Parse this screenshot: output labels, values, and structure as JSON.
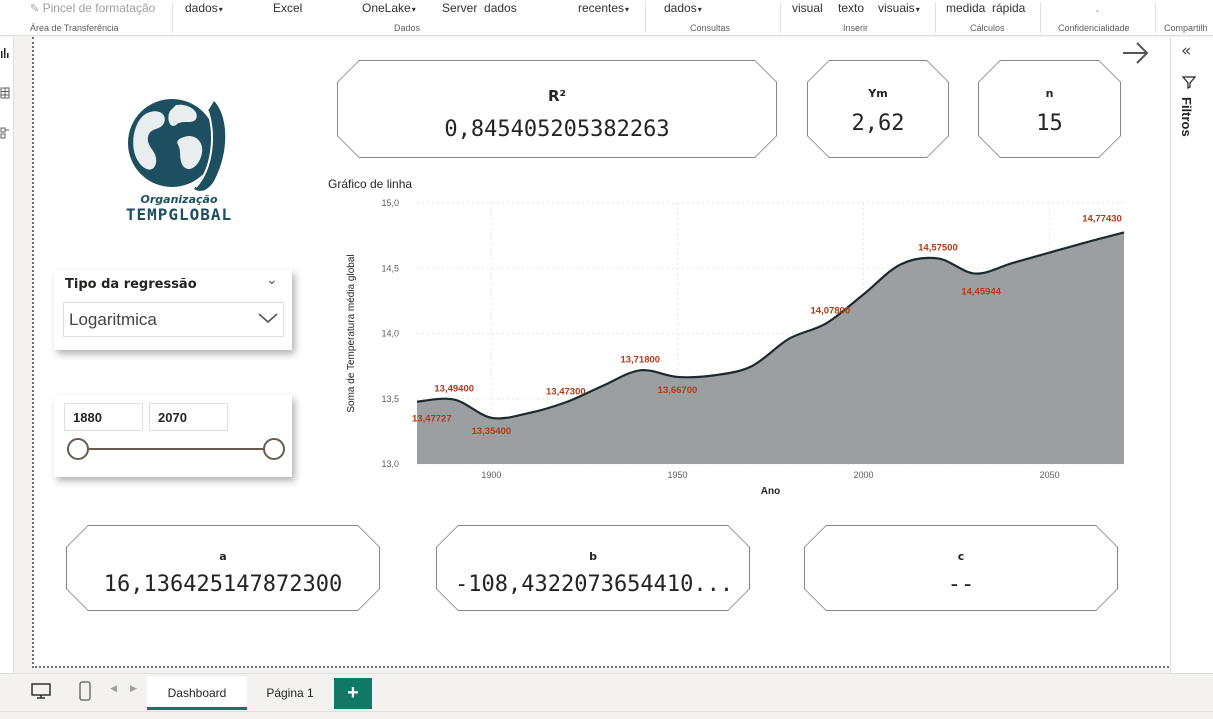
{
  "ribbon": {
    "items": {
      "pincel": "Pincel de formatação",
      "dados1": "dados",
      "excel": "Excel",
      "onelake": "OneLake",
      "server": "Server",
      "dados2": "dados",
      "recentes": "recentes",
      "dados3": "dados",
      "visual": "visual",
      "texto": "texto",
      "visuais": "visuais",
      "medida": "medida",
      "rapida": "rápida"
    },
    "groups": {
      "area": "Área de Transferência",
      "dados": "Dados",
      "consultas": "Consultas",
      "inserir": "Inserir",
      "calculos": "Cálculos",
      "confidencialidade": "Confidencialidade",
      "compartilhar": "Compartilh"
    }
  },
  "filters_pane": {
    "label": "Filtros"
  },
  "logo": {
    "line1": "Organização",
    "line2": "TEMPGLOBAL"
  },
  "cards": {
    "r2": {
      "title": "R²",
      "value": "0,845405205382263"
    },
    "ym": {
      "title": "Ym",
      "value": "2,62"
    },
    "n": {
      "title": "n",
      "value": "15"
    },
    "a": {
      "title": "a",
      "value": "16,136425147872300"
    },
    "b": {
      "title": "b",
      "value": "-108,4322073654410..."
    },
    "c": {
      "title": "c",
      "value": "--"
    }
  },
  "slicer_regressao": {
    "title": "Tipo da regressão",
    "selected": "Logaritmica"
  },
  "slicer_ano": {
    "min": "1880",
    "max": "2070"
  },
  "chart_data": {
    "type": "area",
    "title": "Gráfico de linha",
    "xlabel": "Ano",
    "ylabel": "Soma de Temperatura média global",
    "xlim": [
      1880,
      2070
    ],
    "ylim": [
      13.0,
      15.0
    ],
    "xticks": [
      "1900",
      "1950",
      "2000",
      "2050"
    ],
    "xtick_values": [
      1900,
      1950,
      2000,
      2050
    ],
    "yticks": [
      "13,0",
      "13,5",
      "14,0",
      "14,5",
      "15,0"
    ],
    "ytick_values": [
      13.0,
      13.5,
      14.0,
      14.5,
      15.0
    ],
    "x": [
      1880,
      1890,
      1900,
      1910,
      1920,
      1930,
      1940,
      1950,
      1960,
      1970,
      1980,
      1990,
      2000,
      2010,
      2020,
      2030,
      2040,
      2050,
      2060,
      2070
    ],
    "values": [
      13.47727,
      13.494,
      13.354,
      13.39,
      13.473,
      13.6,
      13.718,
      13.667,
      13.68,
      13.75,
      13.96,
      14.078,
      14.3,
      14.53,
      14.575,
      14.45944,
      14.54,
      14.62,
      14.7,
      14.7743
    ],
    "labels": [
      {
        "x": 1880,
        "y": 13.47727,
        "text": "13,47727"
      },
      {
        "x": 1890,
        "y": 13.494,
        "text": "13,49400"
      },
      {
        "x": 1900,
        "y": 13.354,
        "text": "13,35400"
      },
      {
        "x": 1920,
        "y": 13.473,
        "text": "13,47300"
      },
      {
        "x": 1940,
        "y": 13.718,
        "text": "13,71800"
      },
      {
        "x": 1950,
        "y": 13.667,
        "text": "13,66700"
      },
      {
        "x": 1990,
        "y": 14.078,
        "text": "14,07800"
      },
      {
        "x": 2020,
        "y": 14.575,
        "text": "14,57500"
      },
      {
        "x": 2030,
        "y": 14.45944,
        "text": "14,45944"
      },
      {
        "x": 2070,
        "y": 14.7743,
        "text": "14,77430"
      }
    ],
    "fill_color": "#9b9fa1",
    "line_color": "#1c2a30",
    "label_color": "#b23b16",
    "grid": true
  },
  "tabs": {
    "dashboard": "Dashboard",
    "pagina1": "Página 1",
    "add": "+"
  },
  "colors": {
    "accent": "#117865",
    "logo": "#1d4f60"
  }
}
